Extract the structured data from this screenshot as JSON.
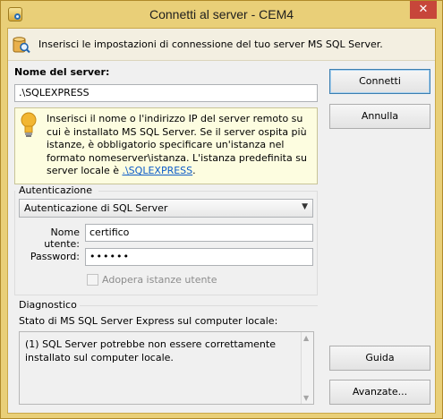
{
  "window": {
    "title": "Connetti al server - CEM4",
    "close_glyph": "✕"
  },
  "header": {
    "text": "Inserisci le impostazioni di connessione del tuo server MS SQL Server."
  },
  "server": {
    "label": "Nome del server:",
    "value": ".\\SQLEXPRESS",
    "hint_text": "Inserisci il nome o l'indirizzo IP del server remoto su cui è installato MS SQL Server. Se il server ospita più istanze, è obbligatorio specificare un'istanza nel formato nomeserver\\istanza. L'istanza predefinita su server locale è ",
    "hint_link": ".\\SQLEXPRESS",
    "hint_end": "."
  },
  "auth": {
    "group_title": "Autenticazione",
    "selected": "Autenticazione di SQL Server",
    "username_label": "Nome utente:",
    "username": "certifico",
    "password_label": "Password:",
    "password": "••••••",
    "instances_label": "Adopera istanze utente"
  },
  "diagnostics": {
    "group_title": "Diagnostico",
    "status": "Stato di MS SQL Server Express sul computer locale:",
    "message": "(1) SQL Server potrebbe non essere correttamente installato sul computer locale."
  },
  "buttons": {
    "connect": "Connetti",
    "cancel": "Annulla",
    "help": "Guida",
    "advanced": "Avanzate..."
  },
  "icons": {
    "header": "database-search-icon",
    "hint": "lightbulb-icon"
  },
  "colors": {
    "title_bar": "#e9cf78",
    "hint_bg": "#fdfde0",
    "link": "#0d5cc8"
  }
}
